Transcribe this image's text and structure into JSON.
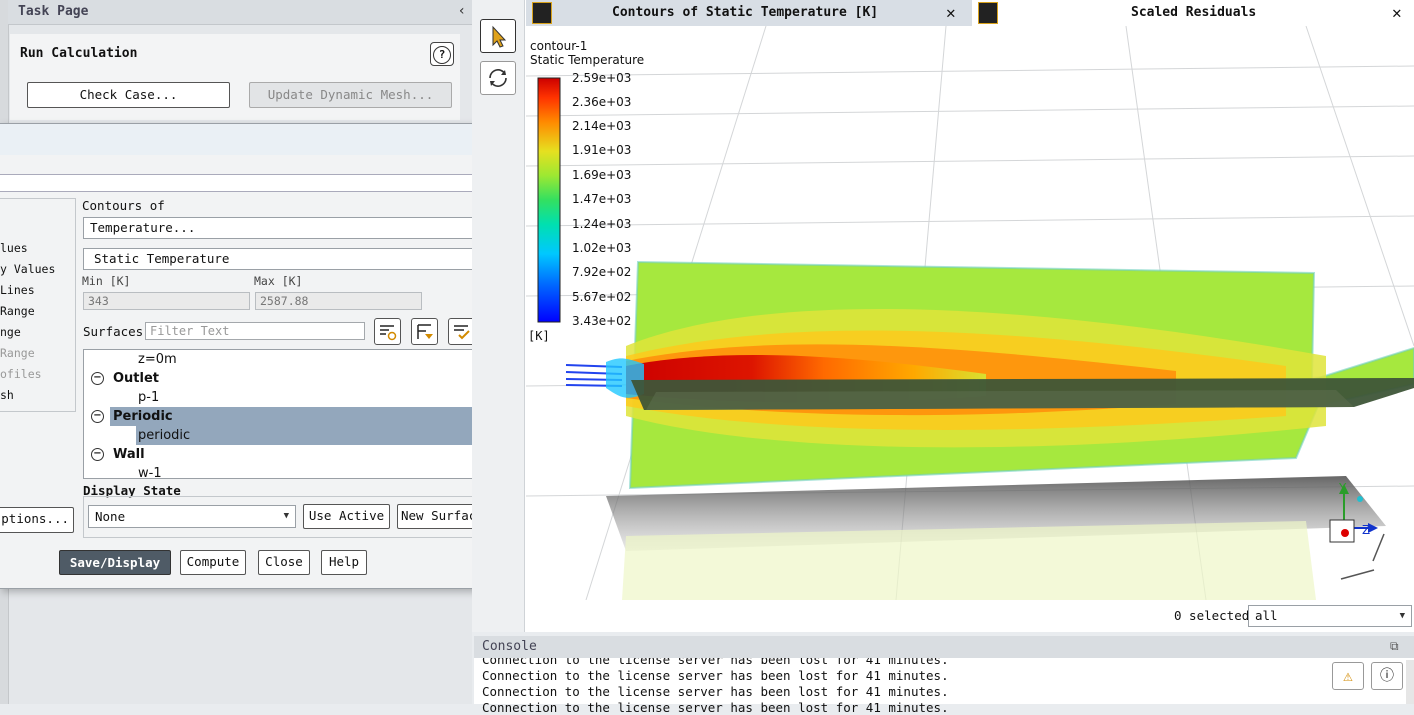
{
  "task_page": {
    "header": "Task Page",
    "section_title": "Run Calculation",
    "check_case_label": "Check Case...",
    "update_mesh_label": "Update Dynamic Mesh..."
  },
  "dialog": {
    "options": [
      "lues",
      "y Values",
      "Lines",
      "Range",
      "nge",
      "Range",
      "ofiles",
      "sh"
    ],
    "contours_of_label": "Contours of",
    "contours_of_value": "Temperature...",
    "sub_value": "Static Temperature",
    "min_label": "Min [K]",
    "max_label": "Max [K]",
    "min_value": "343",
    "max_value": "2587.88",
    "surfaces_label": "Surfaces",
    "filter_placeholder": "Filter Text",
    "surfaces": [
      {
        "text": "z=0m",
        "level": 1
      },
      {
        "text": "Outlet",
        "level": 0
      },
      {
        "text": "p-1",
        "level": 1
      },
      {
        "text": "Periodic",
        "level": 0,
        "selected": true
      },
      {
        "text": "periodic",
        "level": 1,
        "selected": true
      },
      {
        "text": "Wall",
        "level": 0
      },
      {
        "text": "w-1",
        "level": 1
      }
    ],
    "display_state_label": "Display State",
    "display_state_value": "None",
    "use_active_label": "Use Active",
    "new_surface_label": "New Surface",
    "options_button_label": "ptions...",
    "save_display_label": "Save/Display",
    "compute_label": "Compute",
    "close_label": "Close",
    "help_label": "Help"
  },
  "graphics": {
    "tab1_title": "Contours of Static Temperature [K]",
    "tab2_title": "Scaled Residuals",
    "contour_name": "contour-1",
    "colorbar_title": "Static Temperature",
    "colorbar_ticks": [
      "2.59e+03",
      "2.36e+03",
      "2.14e+03",
      "1.91e+03",
      "1.69e+03",
      "1.47e+03",
      "1.24e+03",
      "1.02e+03",
      "7.92e+02",
      "5.67e+02",
      "3.43e+02"
    ],
    "colorbar_unit": "[K]",
    "axis_labels": {
      "y": "Y",
      "z": "Z"
    },
    "selected_text": "0 selected",
    "filter_select_value": "all"
  },
  "console": {
    "header": "Console",
    "lines": [
      "Connection to the license server has been lost for 41 minutes.",
      "Connection to the license server has been lost for 41 minutes.",
      "Connection to the license server has been lost for 41 minutes.",
      "Connection to the license server has been lost for 41 minutes."
    ]
  },
  "colors": {
    "highlight": "#93a7bc",
    "primary_button": "#4f5b66"
  }
}
